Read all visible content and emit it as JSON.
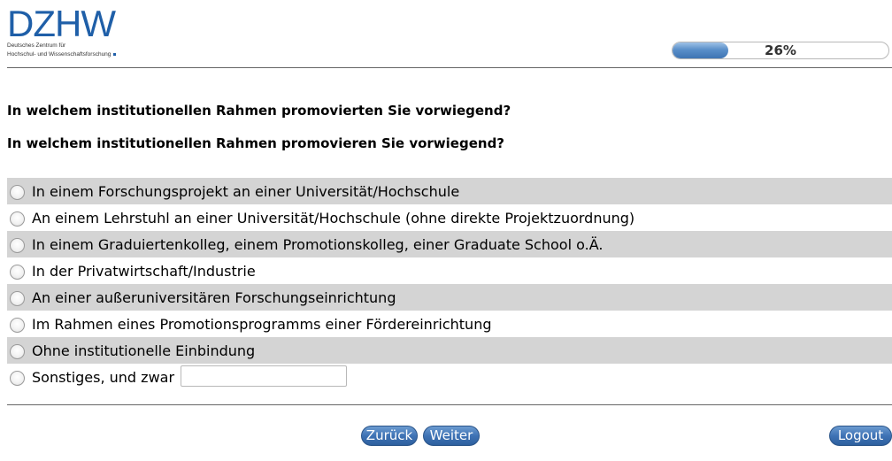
{
  "logo": {
    "wordmark": "DZHW",
    "subline1": "Deutsches Zentrum für",
    "subline2": "Hochschul- und Wissenschaftsforschung"
  },
  "progress": {
    "value": 0.26,
    "label": "26%"
  },
  "questions": [
    "In welchem institutionellen Rahmen promovierten Sie vorwiegend?",
    "In welchem institutionellen Rahmen promovieren Sie vorwiegend?"
  ],
  "options": [
    "In einem Forschungsprojekt an einer Universität/Hochschule",
    "An einem Lehrstuhl an einer Universität/Hochschule (ohne direkte Projektzuordnung)",
    "In einem Graduiertenkolleg, einem Promotionskolleg, einer Graduate School o.Ä.",
    "In der Privatwirtschaft/Industrie",
    "An einer außeruniversitären Forschungseinrichtung",
    "Im Rahmen eines Promotionsprogramms einer Fördereinrichtung",
    "Ohne institutionelle Einbindung",
    "Sonstiges, und zwar"
  ],
  "other_input": {
    "value": "",
    "placeholder": ""
  },
  "nav": {
    "back_label": "Zurück",
    "next_label": "Weiter",
    "logout_label": "Logout"
  },
  "colors": {
    "brand": "#1f5fa8",
    "button": "#3f73b5",
    "shaded_row": "#d4d4d4"
  }
}
